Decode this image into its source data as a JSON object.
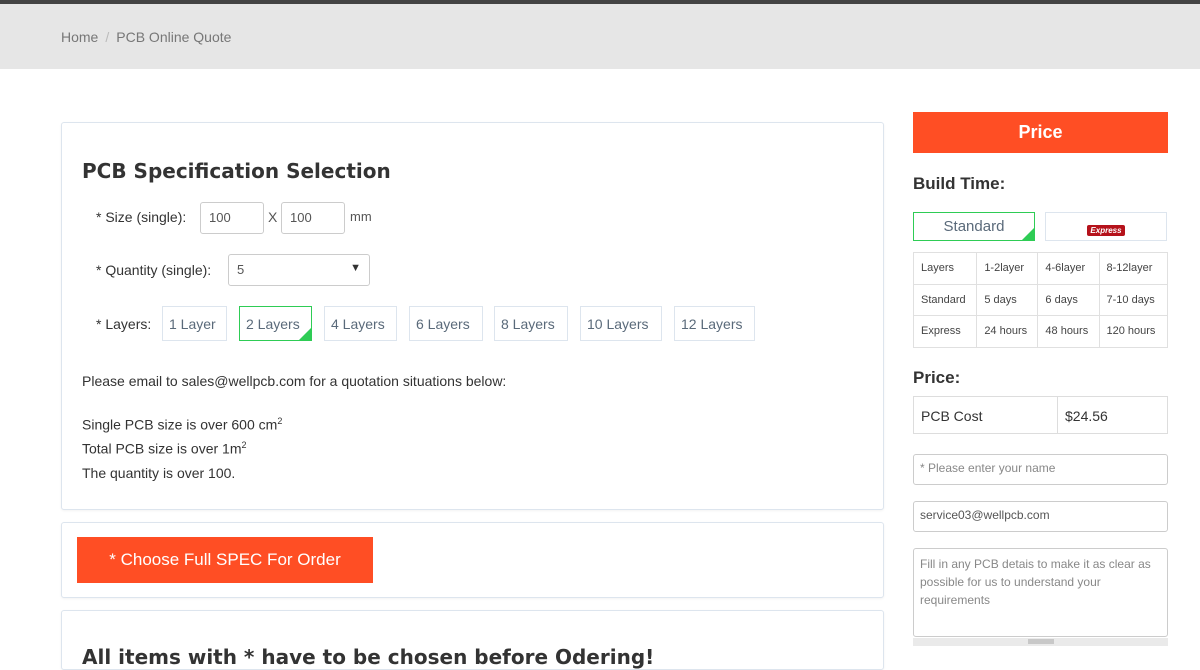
{
  "breadcrumb": {
    "home": "Home",
    "separator": "/",
    "current": "PCB Online Quote"
  },
  "spec": {
    "title": "PCB Specification Selection",
    "size_label": "* Size (single):",
    "size_w": "100",
    "size_x": "X",
    "size_h": "100",
    "size_unit": "mm",
    "qty_label": "* Quantity (single):",
    "qty_value": "5",
    "layers_label": "* Layers:",
    "layers": [
      "1 Layer",
      "2 Layers",
      "4 Layers",
      "6 Layers",
      "8 Layers",
      "10 Layers",
      "12 Layers"
    ],
    "selected_layer": "2 Layers",
    "email_note": "Please email to sales@wellpcb.com for a quotation situations below:",
    "cond1": "Single PCB size is over 600 cm",
    "cond1_sup": "2",
    "cond2": "Total PCB size is over 1m",
    "cond2_sup": "2",
    "cond3": "The quantity is over 100."
  },
  "order_button": "* Choose Full SPEC For Order",
  "notice": "All items with * have to be chosen before Odering!",
  "side": {
    "price_header": "Price",
    "build_time": "Build Time:",
    "standard": "Standard",
    "express": "Express",
    "table": [
      [
        "Layers",
        "1-2layer",
        "4-6layer",
        "8-12layer"
      ],
      [
        "Standard",
        "5 days",
        "6 days",
        "7-10 days"
      ],
      [
        "Express",
        "24 hours",
        "48 hours",
        "120 hours"
      ]
    ],
    "price_label": "Price:",
    "pcb_cost_label": "PCB Cost",
    "pcb_cost": "$24.56",
    "name_placeholder": "* Please enter your name",
    "email_value": "service03@wellpcb.com",
    "details_placeholder": "Fill in any PCB detais to make it as clear as possible for us to understand your requirements"
  },
  "colors": {
    "accent": "#ff4e24",
    "selected": "#2ecc55"
  }
}
